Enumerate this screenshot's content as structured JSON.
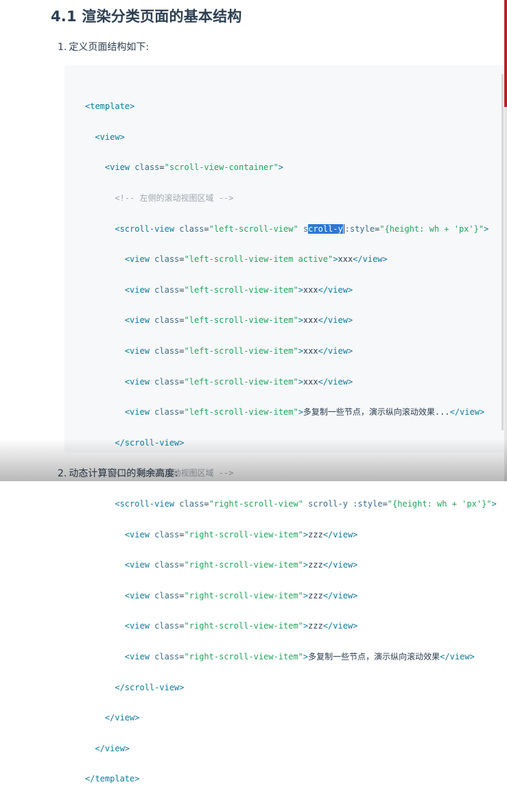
{
  "heading": "4.1 渲染分类页面的基本结构",
  "steps": [
    {
      "num": "1.",
      "text": "定义页面结构如下:"
    },
    {
      "num": "2.",
      "text": "动态计算窗口的剩余高度:"
    }
  ],
  "code": {
    "l1": "<template>",
    "l2": "<view>",
    "l3_tag": "<view",
    "l3_attr": "class",
    "l3_val": "\"scroll-view-container\"",
    "l4": "<!-- 左侧的滚动视图区域 -->",
    "l5_tag": "<scroll-view",
    "l5_attr": "class",
    "l5_val": "\"left-scroll-view\"",
    "l5_s": "s",
    "l5_sel": "croll-y",
    "l5_style": ":style",
    "l5_style_val": "\"{height: wh + 'px'}\"",
    "item_tag": "<view",
    "item_attr": "class",
    "left_item_active": "\"left-scroll-view-item active\"",
    "left_item": "\"left-scroll-view-item\"",
    "xxx": "xxx",
    "more_left": "多复制一些节点，演示纵向滚动效果...",
    "close_view": "</view>",
    "close_scroll": "</scroll-view>",
    "l13": "<!-- 右侧的滚动视图区域 -->",
    "l14_val": "\"right-scroll-view\"",
    "l14_scrolly": "scroll-y",
    "right_item": "\"right-scroll-view-item\"",
    "zzz": "zzz",
    "more_right": "多复制一些节点，演示纵向滚动效果",
    "close_template": "</template>"
  },
  "colors": {
    "tag": "#0f7a9b",
    "string": "#23a45c",
    "comment": "#a0a7ae",
    "selection": "#2a7ad6",
    "edge_red": "#b8202a"
  }
}
